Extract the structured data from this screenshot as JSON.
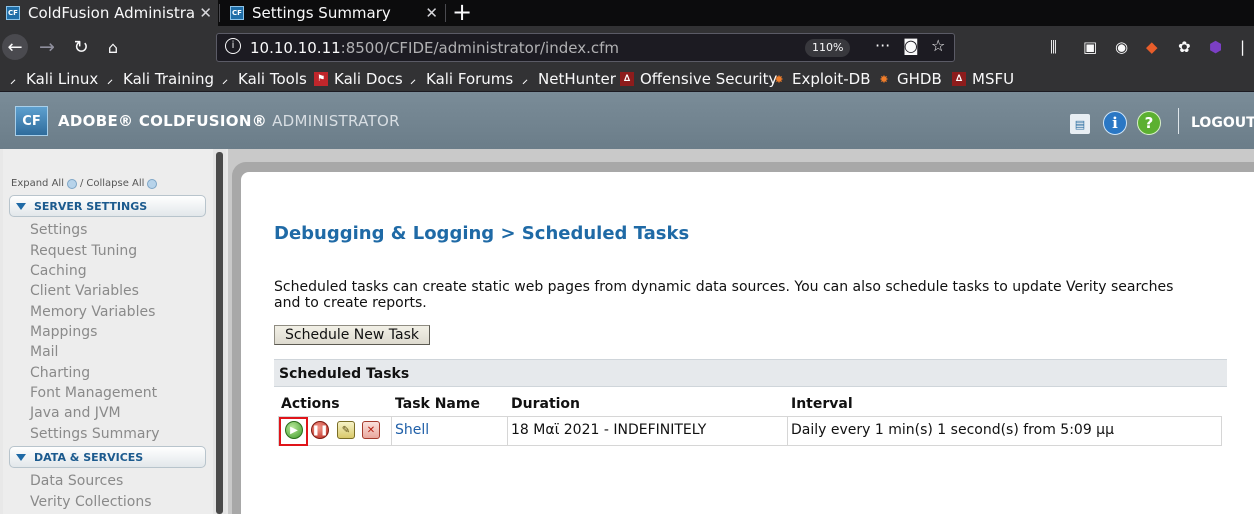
{
  "browser": {
    "tabs": [
      {
        "title": "ColdFusion Administrator",
        "active": true
      },
      {
        "title": "Settings Summary",
        "active": false
      }
    ],
    "url": {
      "host": "10.10.10.11",
      "path": ":8500/CFIDE/administrator/index.cfm"
    },
    "zoom": "110%",
    "bookmarks": [
      "Kali Linux",
      "Kali Training",
      "Kali Tools",
      "Kali Docs",
      "Kali Forums",
      "NetHunter",
      "Offensive Security",
      "Exploit-DB",
      "GHDB",
      "MSFU"
    ]
  },
  "header": {
    "logo": "CF",
    "product": "ADOBE® COLDFUSION®",
    "subtitle": "ADMINISTRATOR",
    "logout": "LOGOUT",
    "icons": [
      "sitemap-icon",
      "info-icon",
      "help-icon"
    ]
  },
  "sidebar": {
    "expand_all": "Expand All",
    "collapse_all": "Collapse All",
    "sections": [
      {
        "title": "SERVER SETTINGS",
        "items": [
          "Settings",
          "Request Tuning",
          "Caching",
          "Client Variables",
          "Memory Variables",
          "Mappings",
          "Mail",
          "Charting",
          "Font Management",
          "Java and JVM",
          "Settings Summary"
        ]
      },
      {
        "title": "DATA & SERVICES",
        "items": [
          "Data Sources",
          "Verity Collections"
        ]
      }
    ]
  },
  "main": {
    "title": "Debugging & Logging > Scheduled Tasks",
    "description": "Scheduled tasks can create static web pages from dynamic data sources. You can also schedule tasks to update Verity searches and to create reports.",
    "new_task_button": "Schedule New Task",
    "table": {
      "heading": "Scheduled Tasks",
      "columns": [
        "Actions",
        "Task Name",
        "Duration",
        "Interval"
      ],
      "rows": [
        {
          "task_name": "Shell",
          "duration": "18 Μαϊ 2021 - INDEFINITELY",
          "interval": "Daily every 1 min(s) 1 second(s) from 5:09 μμ"
        }
      ]
    }
  },
  "colors": {
    "accent": "#1f6aa6",
    "highlight": "#e0141a"
  }
}
